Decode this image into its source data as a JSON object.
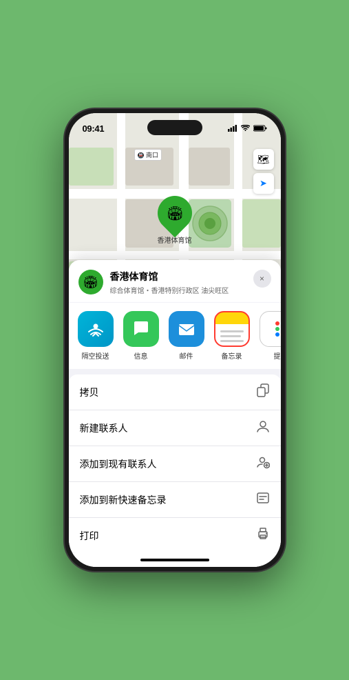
{
  "status_bar": {
    "time": "09:41",
    "signal_label": "signal",
    "wifi_label": "wifi",
    "battery_label": "battery"
  },
  "map": {
    "label": "南口",
    "controls": {
      "map_icon": "🗺",
      "location_icon": "➤"
    },
    "pin_label": "香港体育馆",
    "pin_emoji": "🏟"
  },
  "location_header": {
    "name": "香港体育馆",
    "subtitle": "综合体育馆・香港特别行政区 油尖旺区",
    "close_label": "×",
    "icon_emoji": "🏟"
  },
  "share_items": [
    {
      "id": "airdrop",
      "label": "隔空投送",
      "emoji": "📡"
    },
    {
      "id": "messages",
      "label": "信息",
      "emoji": "💬"
    },
    {
      "id": "mail",
      "label": "邮件",
      "emoji": "✉"
    },
    {
      "id": "notes",
      "label": "备忘录",
      "selected": true
    },
    {
      "id": "more",
      "label": "提"
    }
  ],
  "actions": [
    {
      "id": "copy",
      "label": "拷贝",
      "icon": "copy"
    },
    {
      "id": "new-contact",
      "label": "新建联系人",
      "icon": "person"
    },
    {
      "id": "add-contact",
      "label": "添加到现有联系人",
      "icon": "person-add"
    },
    {
      "id": "quick-note",
      "label": "添加到新快速备忘录",
      "icon": "note"
    },
    {
      "id": "print",
      "label": "打印",
      "icon": "printer"
    }
  ]
}
